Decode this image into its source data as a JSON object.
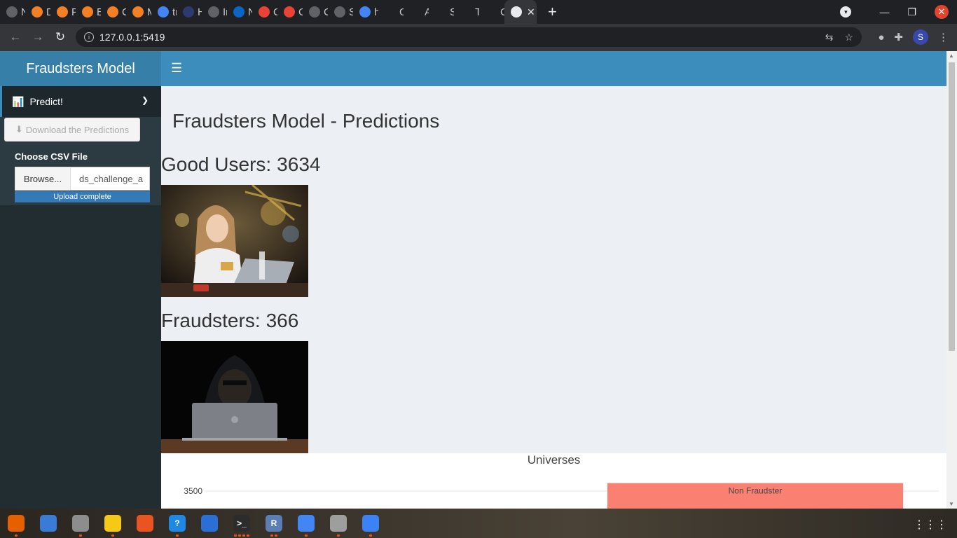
{
  "browser": {
    "tabs": [
      {
        "label": "Ne",
        "fav_color": "#5f6368",
        "fav": "chrome-icon"
      },
      {
        "label": "Da",
        "fav_color": "#f48024",
        "fav": "stack-icon"
      },
      {
        "label": "Pr",
        "fav_color": "#f48024",
        "fav": "book-icon"
      },
      {
        "label": "El",
        "fav_color": "#f48024",
        "fav": "book-icon"
      },
      {
        "label": "Cl",
        "fav_color": "#f48024",
        "fav": "book-icon"
      },
      {
        "label": "M",
        "fav_color": "#f48024",
        "fav": "book-icon"
      },
      {
        "label": "tr",
        "fav_color": "#4285f4",
        "fav": "google-icon"
      },
      {
        "label": "He",
        "fav_color": "#2e3a6e",
        "fav": "tds-icon"
      },
      {
        "label": "In",
        "fav_color": "#5f6368",
        "fav": "globe-icon"
      },
      {
        "label": "Ne",
        "fav_color": "#0a66c2",
        "fav": "linkedin-icon"
      },
      {
        "label": "Ch",
        "fav_color": "#ea4335",
        "fav": "gmail-icon"
      },
      {
        "label": "Ch",
        "fav_color": "#ea4335",
        "fav": "gmail-icon"
      },
      {
        "label": "Co",
        "fav_color": "#5f6368",
        "fav": "globe-icon"
      },
      {
        "label": "St",
        "fav_color": "#5f6368",
        "fav": "doc-icon"
      },
      {
        "label": "ho",
        "fav_color": "#4285f4",
        "fav": "google-icon"
      },
      {
        "label": "Gi",
        "fav_color": "#202124",
        "fav": "github-icon"
      },
      {
        "label": "Ag",
        "fav_color": "#202124",
        "fav": "github-icon"
      },
      {
        "label": "Sa",
        "fav_color": "#202124",
        "fav": "github-icon"
      },
      {
        "label": "To",
        "fav_color": "#202124",
        "fav": "github-icon"
      },
      {
        "label": "Cr",
        "fav_color": "#202124",
        "fav": "github-icon"
      }
    ],
    "active_tab_close": "✕",
    "url": "127.0.0.1:5419"
  },
  "app": {
    "logo": "Fraudsters Model",
    "menu_item": "Predict!",
    "download_label": "Download the Predictions",
    "csv_label": "Choose CSV File",
    "browse_label": "Browse...",
    "file_name": "ds_challenge_a",
    "upload_status": "Upload complete",
    "page_title": "Fraudsters Model - Predictions",
    "good_users_label": "Good Users:",
    "good_users_count": "3634",
    "fraudsters_label": "Fraudsters:",
    "fraudsters_count": "366"
  },
  "chart_data": {
    "type": "bar",
    "title": "Universes",
    "categories": [
      "Non Fraudster"
    ],
    "values": [
      3634
    ],
    "ytick_visible": "3500",
    "colors": [
      "#fa8072"
    ]
  },
  "taskbar": {
    "apps": [
      {
        "name": "firefox-icon",
        "color": "#e66000",
        "glyph": "",
        "dots": 1
      },
      {
        "name": "thunderbird-icon",
        "color": "#3a7bd5",
        "glyph": "",
        "dots": 0
      },
      {
        "name": "files-icon",
        "color": "#8d8d8d",
        "glyph": "",
        "dots": 1
      },
      {
        "name": "rhythmbox-icon",
        "color": "#f6c915",
        "glyph": "",
        "dots": 1
      },
      {
        "name": "software-icon",
        "color": "#e95420",
        "glyph": "",
        "dots": 0
      },
      {
        "name": "help-icon",
        "color": "#1e88e5",
        "glyph": "?",
        "dots": 1
      },
      {
        "name": "writer-icon",
        "color": "#2a6fd6",
        "glyph": "",
        "dots": 0
      },
      {
        "name": "terminal-icon",
        "color": "#2c2c2c",
        "glyph": ">_",
        "dots": 4
      },
      {
        "name": "r-icon",
        "color": "#5b7fb5",
        "glyph": "R",
        "dots": 2
      },
      {
        "name": "chrome-icon",
        "color": "#4285f4",
        "glyph": "",
        "dots": 1
      },
      {
        "name": "image-viewer-icon",
        "color": "#9e9e9e",
        "glyph": "",
        "dots": 1
      },
      {
        "name": "text-editor-icon",
        "color": "#3b82f6",
        "glyph": "",
        "dots": 1
      }
    ]
  }
}
